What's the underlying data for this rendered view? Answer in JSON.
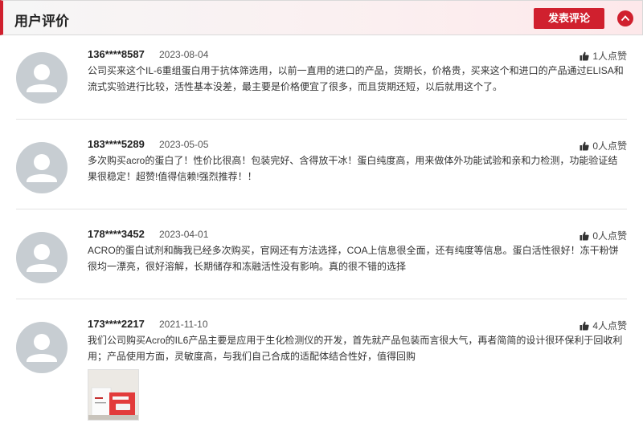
{
  "header": {
    "title": "用户评价",
    "post_button": "发表评论",
    "accent_color": "#d0202e"
  },
  "reviews": [
    {
      "user": "136****8587",
      "date": "2023-08-04",
      "likes": "1人点赞",
      "text": "公司买来这个IL-6重组蛋白用于抗体筛选用，以前一直用的进口的产品，货期长，价格贵，买来这个和进口的产品通过ELISA和流式实验进行比较，活性基本没差，最主要是价格便宜了很多，而且货期还短，以后就用这个了。",
      "avatar_icon": "user-avatar-icon"
    },
    {
      "user": "183****5289",
      "date": "2023-05-05",
      "likes": "0人点赞",
      "text": "多次购买acro的蛋白了！性价比很高！包装完好、含得放干冰！蛋白纯度高，用来做体外功能试验和亲和力检测，功能验证结果很稳定！超赞!值得信赖!强烈推荐！！",
      "avatar_icon": "user-avatar-icon"
    },
    {
      "user": "178****3452",
      "date": "2023-04-01",
      "likes": "0人点赞",
      "text": "ACRO的蛋白试剂和酶我已经多次购买，官网还有方法选择，COA上信息很全面，还有纯度等信息。蛋白活性很好！冻干粉饼很均一漂亮，很好溶解，长期储存和冻融活性没有影响。真的很不错的选择",
      "avatar_icon": "user-avatar-icon"
    },
    {
      "user": "173****2217",
      "date": "2021-11-10",
      "likes": "4人点赞",
      "text": "我们公司购买Acro的IL6产品主要是应用于生化检测仪的开发，首先就产品包装而言很大气，再者简简的设计很环保利于回收利用；产品使用方面，灵敏度高，与我们自己合成的适配体结合性好，值得回购",
      "avatar_icon": "user-avatar-icon",
      "has_photo": true
    }
  ]
}
